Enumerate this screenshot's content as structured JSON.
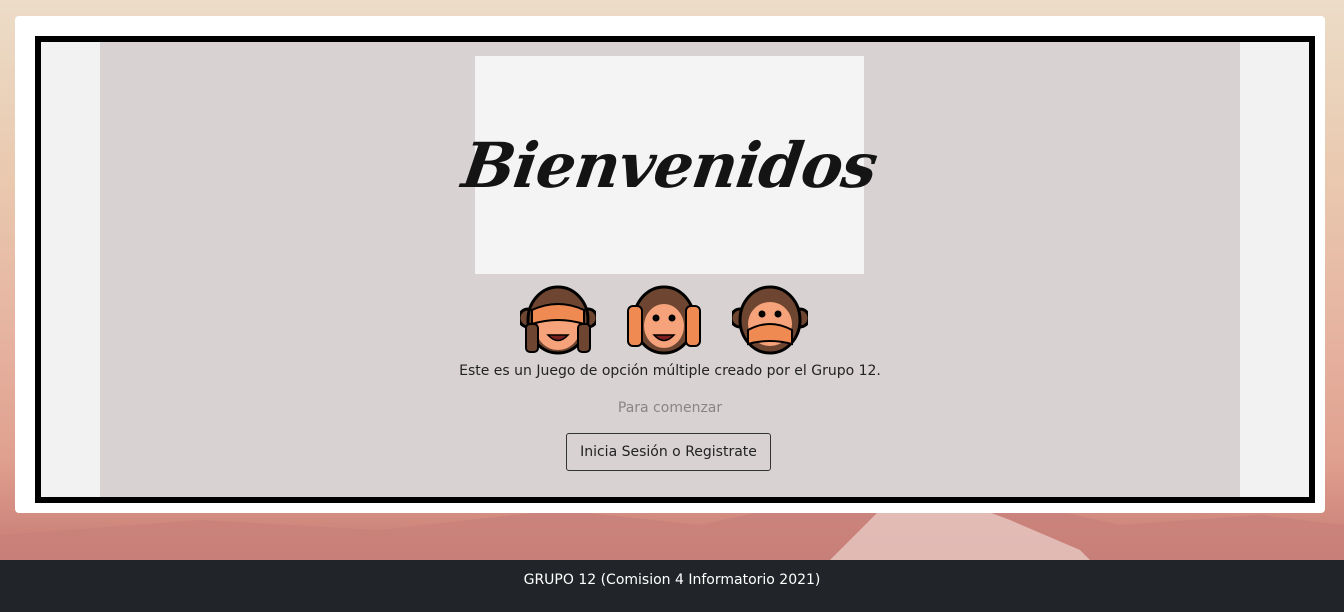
{
  "banner": {
    "title": "Bienvenidos"
  },
  "monkeys": [
    {
      "icon": "see-no-evil-monkey-icon"
    },
    {
      "icon": "hear-no-evil-monkey-icon"
    },
    {
      "icon": "speak-no-evil-monkey-icon"
    }
  ],
  "main": {
    "description": "Este es un Juego de opción múltiple creado por el Grupo 12.",
    "prompt": "Para comenzar",
    "login_button": "Inicia Sesión o Registrate"
  },
  "footer": {
    "text": "GRUPO 12 (Comision 4 Informatorio 2021)"
  },
  "colors": {
    "frame_border": "#000000",
    "panel_bg": "#d8d2d3",
    "footer_bg": "#212529",
    "monkey_fur": "#6d4530",
    "monkey_face": "#f6a27a",
    "monkey_hands": "#f08a53"
  }
}
